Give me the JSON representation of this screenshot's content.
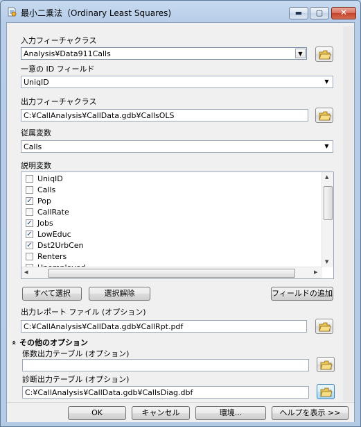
{
  "window": {
    "title": "最小二乗法（Ordinary Least Squares)",
    "controls": {
      "minimize": "▬",
      "maximize": "▢",
      "close": "✕"
    }
  },
  "input_feature_class": {
    "label": "入力フィーチャクラス",
    "value": "Analysis¥Data911Calls"
  },
  "unique_id_field": {
    "label": "一意の ID フィールド",
    "value": "UniqID"
  },
  "output_feature_class": {
    "label": "出力フィーチャクラス",
    "value": "C:¥CallAnalysis¥CallData.gdb¥CallsOLS"
  },
  "dependent_variable": {
    "label": "従属変数",
    "value": "Calls"
  },
  "explanatory_variables": {
    "label": "説明変数",
    "items": [
      {
        "name": "UniqID",
        "checked": false
      },
      {
        "name": "Calls",
        "checked": false
      },
      {
        "name": "Pop",
        "checked": true
      },
      {
        "name": "CallRate",
        "checked": false
      },
      {
        "name": "Jobs",
        "checked": true
      },
      {
        "name": "LowEduc",
        "checked": true
      },
      {
        "name": "Dst2UrbCen",
        "checked": true
      },
      {
        "name": "Renters",
        "checked": false
      },
      {
        "name": "Unemployed",
        "checked": false
      }
    ],
    "select_all": "すべて選択",
    "unselect_all": "選択解除",
    "add_field": "フィールドの追加"
  },
  "output_report_file": {
    "label": "出力レポート ファイル (オプション)",
    "value": "C:¥CallAnalysis¥CallData.gdb¥CallRpt.pdf"
  },
  "other_options": {
    "label": "その他のオプション",
    "toggle_glyph": "«"
  },
  "coefficient_output_table": {
    "label": "係数出力テーブル (オプション)",
    "value": ""
  },
  "diagnostic_output_table": {
    "label": "診断出力テーブル (オプション)",
    "value": "C:¥CallAnalysis¥CallData.gdb¥CallsDiag.dbf"
  },
  "footer": {
    "ok": "OK",
    "cancel": "キャンセル",
    "environments": "環境...",
    "show_help": "ヘルプを表示 >>"
  },
  "colors": {
    "window_frame": "#b9d1ea",
    "panel": "#f0f0f0",
    "checkmark": "#1c3f7a",
    "close_button": "#c4422c"
  }
}
